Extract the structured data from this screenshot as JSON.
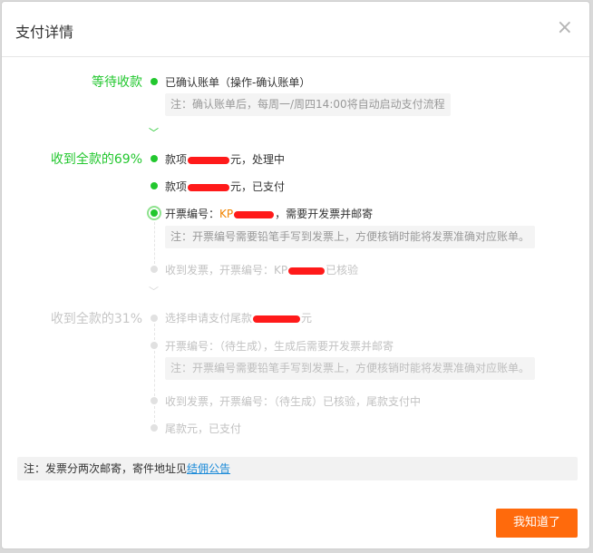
{
  "modal": {
    "title": "支付详情",
    "close_glyph": "×",
    "ok_label": "我知道了"
  },
  "stages": {
    "s1": "等待收款",
    "s2": "收到全款的69%",
    "s3": "收到全款的31%"
  },
  "steps": {
    "s1_step1": "已确认账单（操作-确认账单）",
    "s1_note": "注：确认账单后，每周一/周四14:00将自动启动支付流程",
    "s2_step1_prefix": "款项",
    "s2_step1_suffix": "元，处理中",
    "s2_step2_prefix": "款项",
    "s2_step2_suffix": "元，已支付",
    "s2_step3_prefix": "开票编号：",
    "s2_step3_code": "KP",
    "s2_step3_suffix": "，需要开发票并邮寄",
    "s2_note": "注：开票编号需要铅笔手写到发票上，方便核销时能将发票准确对应账单。",
    "s2_step4_prefix": "收到发票，开票编号：KP",
    "s2_step4_suffix": "已核验",
    "s3_step1_prefix": "选择申请支付尾款",
    "s3_step1_suffix": "元",
    "s3_step2": "开票编号：（待生成），生成后需要开发票并邮寄",
    "s3_note": "注：开票编号需要铅笔手写到发票上，方便核销时能将发票准确对应账单。",
    "s3_step3": "收到发票，开票编号：（待生成）已核验，尾款支付中",
    "s3_step4": "尾款元，已支付"
  },
  "footer": {
    "note_prefix": "注：发票分两次邮寄，寄件地址见",
    "link_label": "结佣公告"
  },
  "icons": {
    "step_dot": "dot",
    "chevron": "chevron-down-icon",
    "close": "close-icon"
  },
  "colors": {
    "accent_green": "#22c72e",
    "accent_orange": "#ff6a0c",
    "link_blue": "#1a8ad8",
    "redaction_red": "#ff1a1a"
  }
}
